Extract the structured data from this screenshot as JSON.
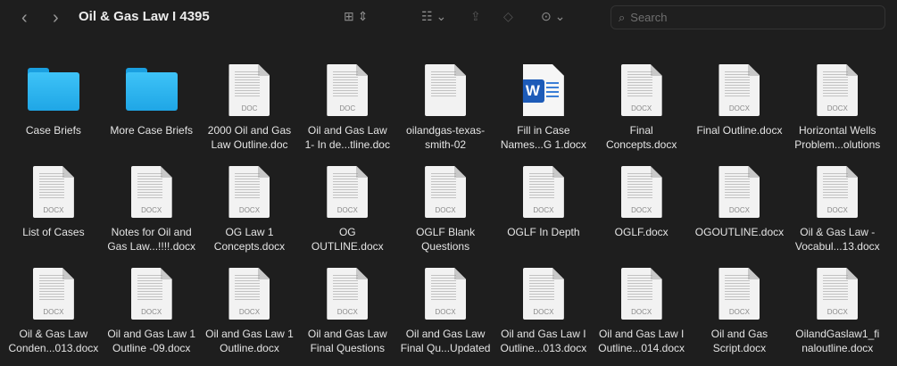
{
  "toolbar": {
    "title": "Oil & Gas Law I 4395",
    "back": "‹",
    "forward": "›",
    "search_placeholder": "Search"
  },
  "items": [
    {
      "type": "folder",
      "l1": "Case Briefs",
      "l2": ""
    },
    {
      "type": "folder",
      "l1": "More Case Briefs",
      "l2": ""
    },
    {
      "type": "doc",
      "ext": "DOC",
      "l1": "2000 Oil and Gas",
      "l2": "Law Outline.doc"
    },
    {
      "type": "doc",
      "ext": "DOC",
      "l1": "Oil and Gas Law",
      "l2": "1- In de...tline.doc"
    },
    {
      "type": "doc",
      "ext": "",
      "l1": "oilandgas-texas-",
      "l2": "smith-02"
    },
    {
      "type": "word",
      "ext": "",
      "l1": "Fill in Case",
      "l2": "Names...G 1.docx"
    },
    {
      "type": "doc",
      "ext": "DOCX",
      "l1": "Final",
      "l2": "Concepts.docx"
    },
    {
      "type": "doc",
      "ext": "DOCX",
      "l1": "Final Outline.docx",
      "l2": ""
    },
    {
      "type": "doc",
      "ext": "DOCX",
      "l1": "Horizontal Wells",
      "l2": "Problem...olutions"
    },
    {
      "type": "doc",
      "ext": "DOCX",
      "l1": "List of Cases",
      "l2": ""
    },
    {
      "type": "doc",
      "ext": "DOCX",
      "l1": "Notes for Oil and",
      "l2": "Gas Law...!!!!.docx"
    },
    {
      "type": "doc",
      "ext": "DOCX",
      "l1": "OG Law 1",
      "l2": "Concepts.docx"
    },
    {
      "type": "doc",
      "ext": "DOCX",
      "l1": "OG",
      "l2": "OUTLINE.docx"
    },
    {
      "type": "doc",
      "ext": "DOCX",
      "l1": "OGLF Blank",
      "l2": "Questions"
    },
    {
      "type": "doc",
      "ext": "DOCX",
      "l1": "OGLF In Depth",
      "l2": ""
    },
    {
      "type": "doc",
      "ext": "DOCX",
      "l1": "OGLF.docx",
      "l2": ""
    },
    {
      "type": "doc",
      "ext": "DOCX",
      "l1": "OGOUTLINE.docx",
      "l2": ""
    },
    {
      "type": "doc",
      "ext": "DOCX",
      "l1": "Oil & Gas Law -",
      "l2": "Vocabul...13.docx"
    },
    {
      "type": "doc",
      "ext": "DOCX",
      "l1": "Oil & Gas Law",
      "l2": "Conden...013.docx"
    },
    {
      "type": "doc",
      "ext": "DOCX",
      "l1": "Oil and Gas Law 1",
      "l2": "Outline -09.docx"
    },
    {
      "type": "doc",
      "ext": "DOCX",
      "l1": "Oil and Gas Law 1",
      "l2": "Outline.docx"
    },
    {
      "type": "doc",
      "ext": "DOCX",
      "l1": "Oil and Gas Law",
      "l2": "Final Questions"
    },
    {
      "type": "doc",
      "ext": "DOCX",
      "l1": "Oil and Gas Law",
      "l2": "Final Qu...Updated"
    },
    {
      "type": "doc",
      "ext": "DOCX",
      "l1": "Oil and Gas Law I",
      "l2": "Outline...013.docx"
    },
    {
      "type": "doc",
      "ext": "DOCX",
      "l1": "Oil and Gas Law I",
      "l2": "Outline...014.docx"
    },
    {
      "type": "doc",
      "ext": "DOCX",
      "l1": "Oil and Gas",
      "l2": "Script.docx"
    },
    {
      "type": "doc",
      "ext": "DOCX",
      "l1": "OilandGaslaw1_fi",
      "l2": "naloutline.docx"
    }
  ]
}
